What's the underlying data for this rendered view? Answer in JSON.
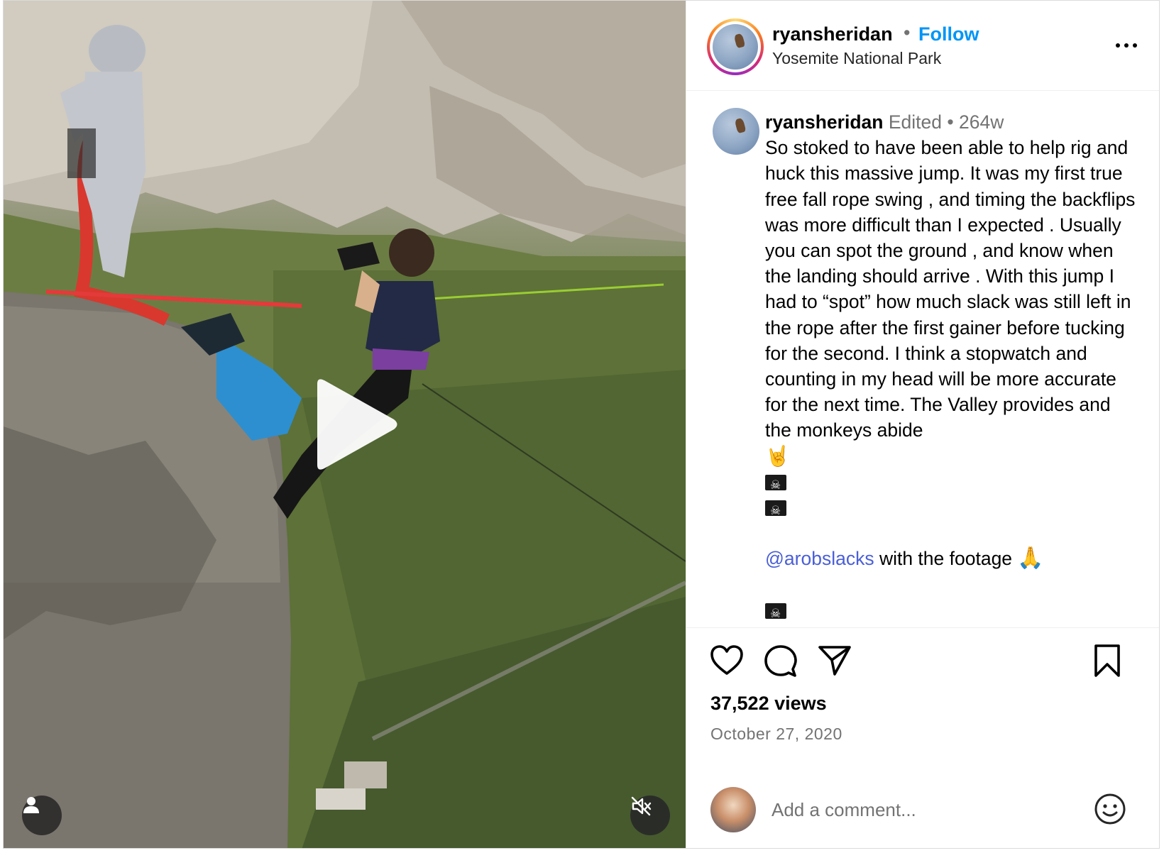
{
  "header": {
    "username": "ryansheridan",
    "separator": "•",
    "follow_label": "Follow",
    "location": "Yosemite National Park",
    "more_icon": "more-horizontal-icon"
  },
  "caption": {
    "username": "ryansheridan",
    "edited": "Edited",
    "separator": "•",
    "age": "264w",
    "text": "So stoked to have been able to help rig and huck this massive jump.  It was my first true free fall rope swing , and timing the backflips was more difficult than I expected . Usually you can spot the ground , and know when the landing should arrive . With this jump I had to “spot” how much slack was still left in the rope after the first gainer before tucking for the second.  I think a stopwatch and counting in my head will be more accurate for the next time. The Valley provides and the monkeys abide",
    "emojis": [
      "rock-on-hand-emoji",
      "pirate-flag-emoji",
      "pirate-flag-emoji"
    ],
    "mention": "@arobslacks",
    "mention_suffix": " with the footage ",
    "mention_emoji": "folded-hands-emoji"
  },
  "actions": {
    "like_icon": "heart-icon",
    "comment_icon": "comment-icon",
    "share_icon": "share-icon",
    "save_icon": "bookmark-icon"
  },
  "stats": {
    "views": "37,522 views",
    "date": "October 27, 2020"
  },
  "comment_box": {
    "placeholder": "Add a comment...",
    "emoji_icon": "smiley-icon"
  },
  "media": {
    "play_icon": "play-icon",
    "user_tag_icon": "user-icon",
    "mute_icon": "speaker-muted-icon"
  },
  "colors": {
    "accent": "#0095f6",
    "mention": "#4a5fd6",
    "secondary_text": "#737373"
  }
}
